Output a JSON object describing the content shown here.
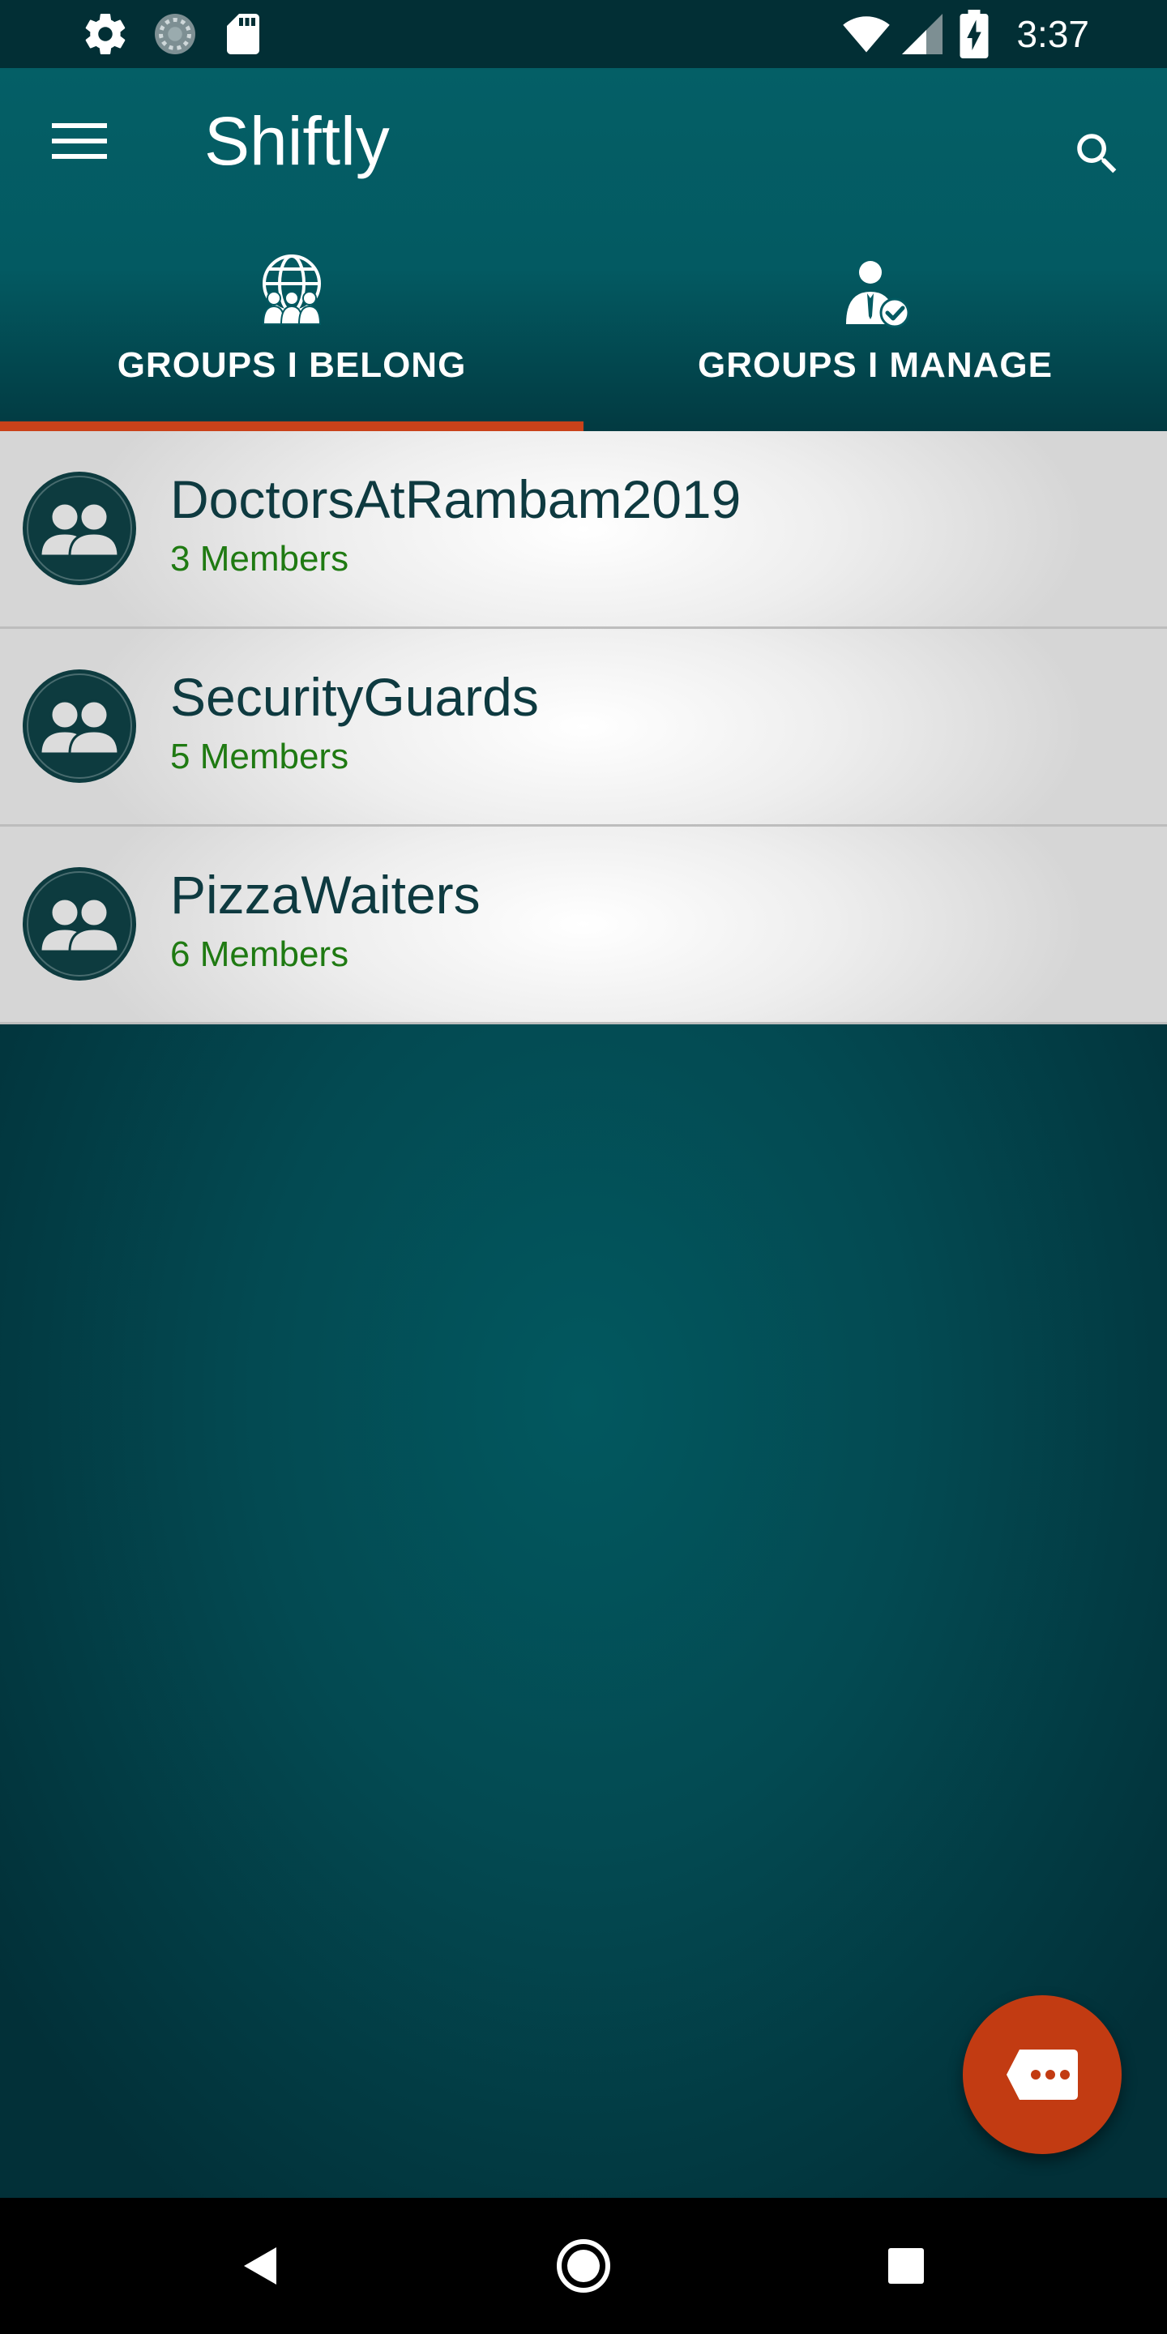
{
  "status_bar": {
    "time": "3:37",
    "icons": [
      "gear-icon",
      "sync-icon",
      "sd-card-icon",
      "wifi-icon",
      "signal-icon",
      "battery-charging-icon"
    ]
  },
  "app_bar": {
    "title": "Shiftly",
    "menu_icon": "hamburger-menu-icon",
    "search_icon": "search-icon"
  },
  "tabs": [
    {
      "label": "GROUPS I BELONG",
      "icon": "globe-group-icon",
      "selected": true
    },
    {
      "label": "GROUPS I MANAGE",
      "icon": "manager-check-icon",
      "selected": false
    }
  ],
  "groups": [
    {
      "name": "DoctorsAtRambam2019",
      "members": "3 Members"
    },
    {
      "name": "SecurityGuards",
      "members": "5 Members"
    },
    {
      "name": "PizzaWaiters",
      "members": "6 Members"
    }
  ],
  "fab": {
    "icon": "chat-bubble-icon"
  },
  "nav_bar": {
    "icons": [
      "back-icon",
      "home-icon",
      "recents-icon"
    ]
  },
  "colors": {
    "primary": "#035a62",
    "status_bar": "#022f35",
    "accent": "#c9421a",
    "fab": "#c23b12",
    "member_text": "#1f7a12",
    "group_name_text": "#0e3a40"
  }
}
